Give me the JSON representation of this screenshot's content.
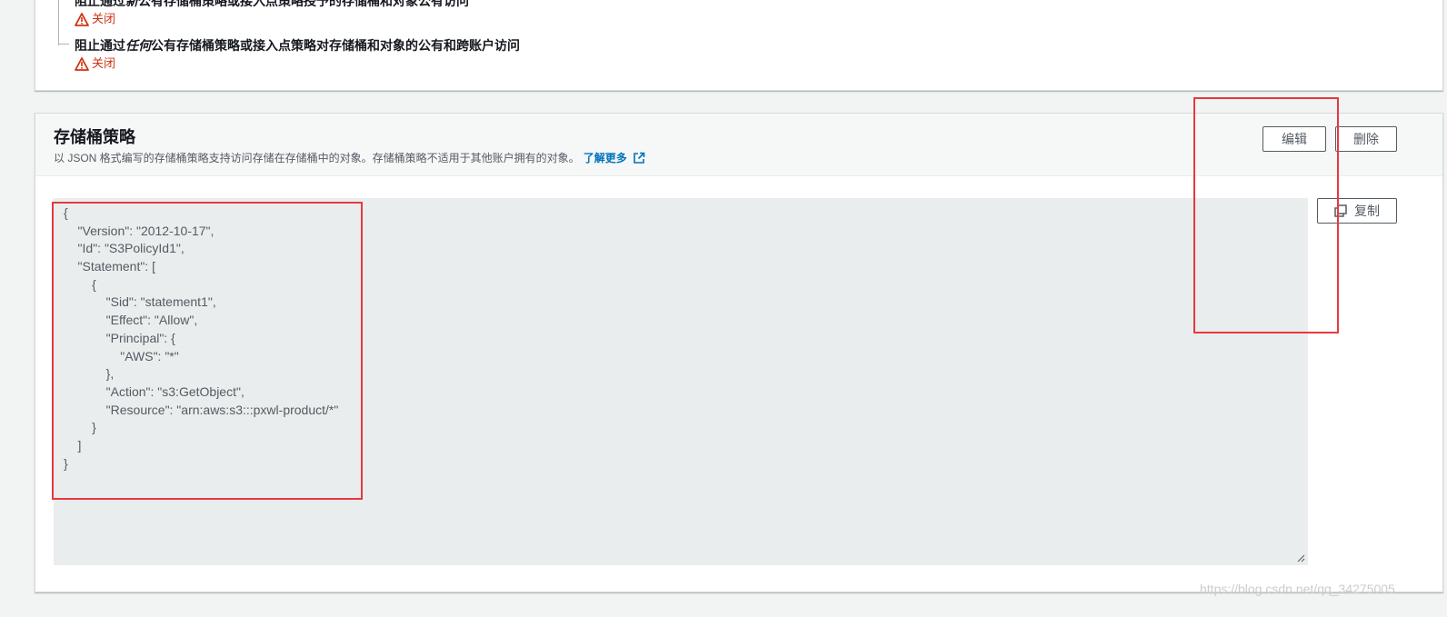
{
  "block_public_access": {
    "items": [
      {
        "title_prefix": "阻止通过",
        "title_emphasis": "新",
        "title_suffix": "公有存储桶策略或接入点策略授予的存储桶和对象公有访问",
        "status": "关闭"
      },
      {
        "title_prefix": "阻止通过",
        "title_emphasis": "任何",
        "title_suffix": "公有存储桶策略或接入点策略对存储桶和对象的公有和跨账户访问",
        "status": "关闭"
      }
    ],
    "status_color": "#d13212"
  },
  "bucket_policy": {
    "title": "存储桶策略",
    "description": "以 JSON 格式编写的存储桶策略支持访问存储在存储桶中的对象。存储桶策略不适用于其他账户拥有的对象。",
    "learn_more": "了解更多",
    "edit_label": "编辑",
    "delete_label": "删除",
    "copy_label": "复制",
    "code_lines": [
      "{",
      "    \"Version\": \"2012-10-17\",",
      "    \"Id\": \"S3PolicyId1\",",
      "    \"Statement\": [",
      "        {",
      "            \"Sid\": \"statement1\",",
      "            \"Effect\": \"Allow\",",
      "            \"Principal\": {",
      "                \"AWS\": \"*\"",
      "            },",
      "            \"Action\": \"s3:GetObject\",",
      "            \"Resource\": \"arn:aws:s3:::pxwl-product/*\"",
      "        }",
      "    ]",
      "}"
    ]
  },
  "watermark": "https://blog.csdn.net/qq_34275005",
  "colors": {
    "accent": "#0073bb",
    "highlight": "#e6393e",
    "background": "#f2f3f3"
  }
}
